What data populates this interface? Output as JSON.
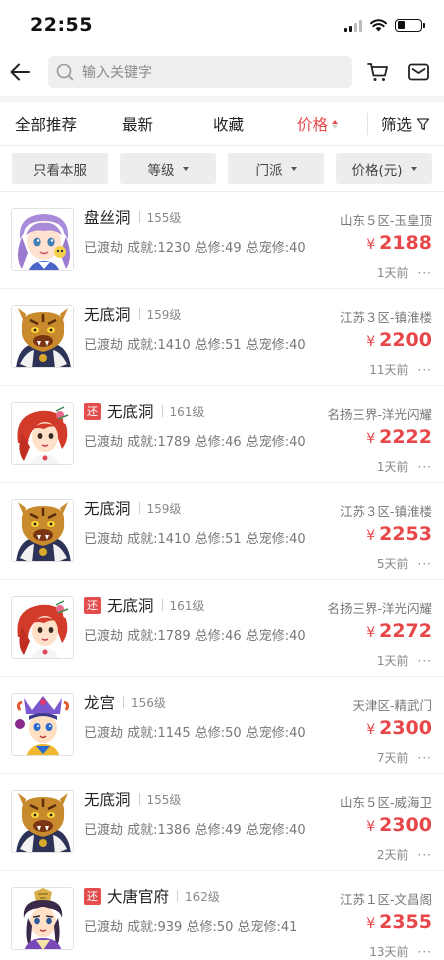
{
  "status_bar": {
    "time": "22:55"
  },
  "search": {
    "placeholder": "输入关键字"
  },
  "tabs": [
    {
      "label": "全部推荐"
    },
    {
      "label": "最新"
    },
    {
      "label": "收藏"
    },
    {
      "label": "价格"
    },
    {
      "label": "筛选"
    }
  ],
  "filters": [
    {
      "label": "只看本服"
    },
    {
      "label": "等级"
    },
    {
      "label": "门派"
    },
    {
      "label": "价格(元)"
    }
  ],
  "currency_symbol": "¥",
  "tag_label": "还",
  "listings": [
    {
      "name": "盘丝洞",
      "level": "155级",
      "stats": "已渡劫 成就:1230 总修:49 总宠修:40",
      "server": "山东５区-玉皇顶",
      "price": "2188",
      "time": "1天前",
      "tagged": false,
      "avatar": "pansi"
    },
    {
      "name": "无底洞",
      "level": "159级",
      "stats": "已渡劫 成就:1410 总修:51 总宠修:40",
      "server": "江苏３区-镇淮楼",
      "price": "2200",
      "time": "11天前",
      "tagged": false,
      "avatar": "tiger"
    },
    {
      "name": "无底洞",
      "level": "161级",
      "stats": "已渡劫 成就:1789 总修:46 总宠修:40",
      "server": "名扬三界-洋光闪耀",
      "price": "2222",
      "time": "1天前",
      "tagged": true,
      "avatar": "redhair"
    },
    {
      "name": "无底洞",
      "level": "159级",
      "stats": "已渡劫 成就:1410 总修:51 总宠修:40",
      "server": "江苏３区-镇淮楼",
      "price": "2253",
      "time": "5天前",
      "tagged": false,
      "avatar": "tiger"
    },
    {
      "name": "无底洞",
      "level": "161级",
      "stats": "已渡劫 成就:1789 总修:46 总宠修:40",
      "server": "名扬三界-洋光闪耀",
      "price": "2272",
      "time": "1天前",
      "tagged": true,
      "avatar": "redhair"
    },
    {
      "name": "龙宫",
      "level": "156级",
      "stats": "已渡劫 成就:1145 总修:50 总宠修:40",
      "server": "天津区-精武门",
      "price": "2300",
      "time": "7天前",
      "tagged": false,
      "avatar": "longgong"
    },
    {
      "name": "无底洞",
      "level": "155级",
      "stats": "已渡劫 成就:1386 总修:49 总宠修:40",
      "server": "山东５区-威海卫",
      "price": "2300",
      "time": "2天前",
      "tagged": false,
      "avatar": "tiger"
    },
    {
      "name": "大唐官府",
      "level": "162级",
      "stats": "已渡劫 成就:939 总修:50 总宠修:41",
      "server": "江苏１区-文昌阁",
      "price": "2355",
      "time": "13天前",
      "tagged": true,
      "avatar": "datang"
    }
  ],
  "colors": {
    "accent": "#e8494a",
    "tag": "#e34d4d"
  }
}
